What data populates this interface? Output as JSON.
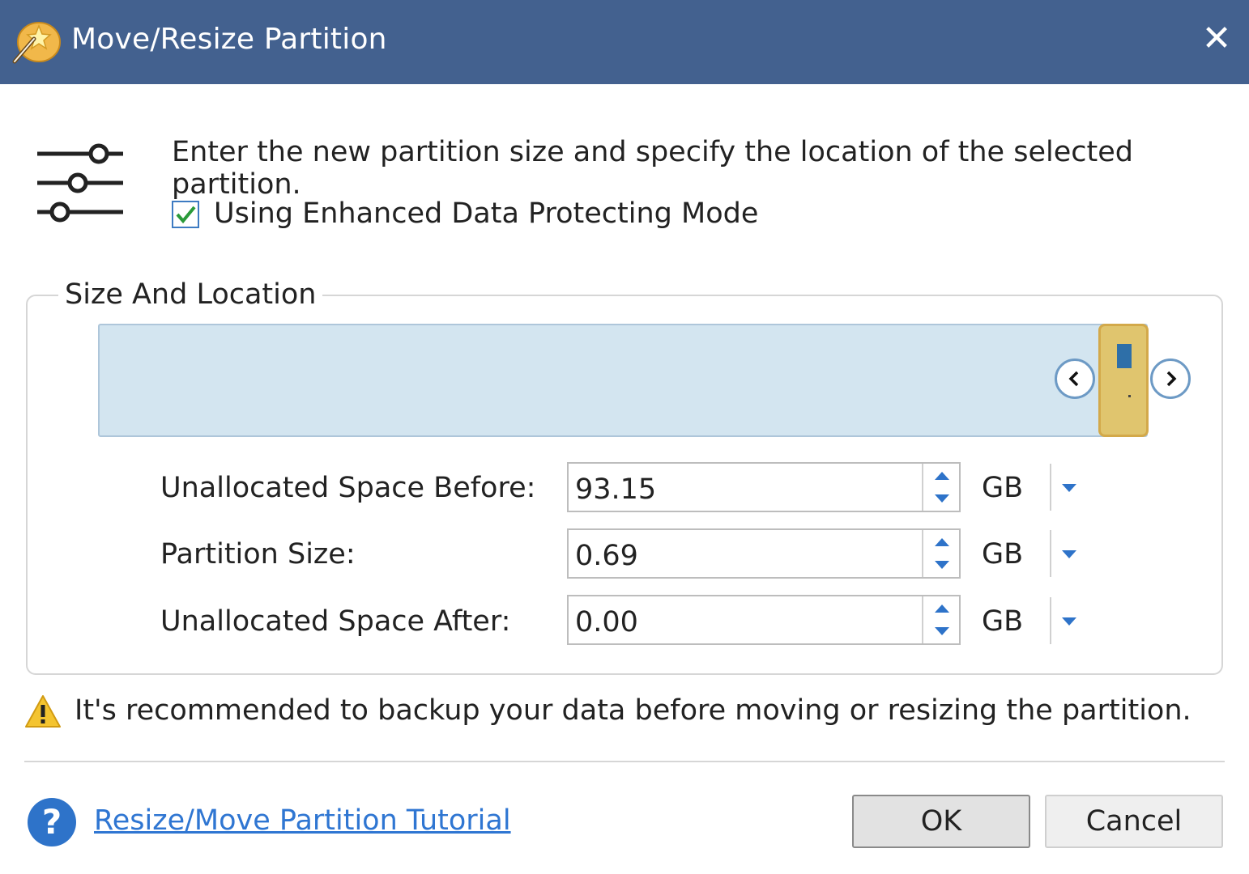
{
  "window": {
    "title": "Move/Resize Partition",
    "close_symbol": "✕",
    "app_icon": "magic-wand-icon"
  },
  "header": {
    "instruction": "Enter the new partition size and specify the location of the selected partition.",
    "settings_icon": "sliders-icon",
    "enhanced_mode_label": "Using Enhanced Data Protecting Mode",
    "enhanced_mode_checked": true
  },
  "size_location": {
    "group_title": "Size And Location",
    "fields": [
      {
        "label": "Unallocated Space Before:",
        "value": "93.15",
        "unit": "GB"
      },
      {
        "label": "Partition Size:",
        "value": "0.69",
        "unit": "GB"
      },
      {
        "label": "Unallocated Space After:",
        "value": "0.00",
        "unit": "GB"
      }
    ]
  },
  "warning": {
    "icon": "warning-icon",
    "text": "It's recommended to backup your data before moving or resizing the partition."
  },
  "footer": {
    "help_symbol": "?",
    "tutorial_link": "Resize/Move Partition Tutorial",
    "ok_label": "OK",
    "cancel_label": "Cancel"
  },
  "colors": {
    "titlebar": "#43618f",
    "disk_bar": "#d3e5f0",
    "partition": "#e0c56e",
    "accent": "#2e73c9"
  }
}
